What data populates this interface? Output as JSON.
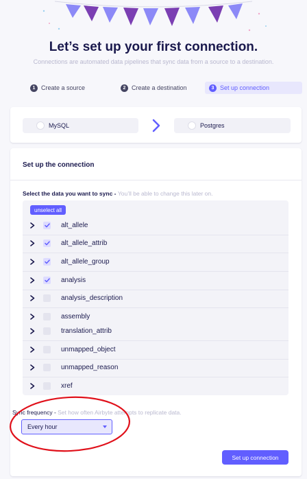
{
  "header": {
    "title": "Let’s set up your first connection.",
    "subtitle": "Connections are automated data pipelines that sync data from a source to a destination."
  },
  "steps": [
    {
      "num": "1",
      "label": "Create a source"
    },
    {
      "num": "2",
      "label": "Create a destination"
    },
    {
      "num": "3",
      "label": "Set up connection"
    }
  ],
  "connection": {
    "source": "MySQL",
    "destination": "Postgres"
  },
  "setup": {
    "heading": "Set up the connection",
    "select_label": "Select the data you want to sync - ",
    "select_hint": "You’ll be able to change this later on.",
    "unselect_all": "unselect all"
  },
  "streams": [
    {
      "name": "alt_allele",
      "checked": true
    },
    {
      "name": "alt_allele_attrib",
      "checked": true
    },
    {
      "name": "alt_allele_group",
      "checked": true
    },
    {
      "name": "analysis",
      "checked": true
    },
    {
      "name": "analysis_description",
      "checked": false
    },
    {
      "name": "assembly",
      "checked": false
    },
    {
      "name": "translation_attrib",
      "checked": false
    },
    {
      "name": "unmapped_object",
      "checked": false
    },
    {
      "name": "unmapped_reason",
      "checked": false
    },
    {
      "name": "xref",
      "checked": false
    }
  ],
  "sync": {
    "label": "Sync frequency - ",
    "hint": "Set how often Airbyte attempts to replicate data.",
    "value": "Every hour"
  },
  "submit_label": "Set up connection",
  "colors": {
    "accent": "#615eff",
    "text": "#1a194d",
    "annotation": "#e0101a"
  }
}
